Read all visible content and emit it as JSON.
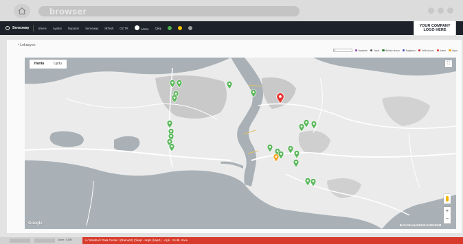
{
  "browser": {
    "url_text": "browser",
    "home_icon": "home-icon"
  },
  "nav": {
    "brand": "Sensoway",
    "items": [
      "Izleme",
      "Ayarlar",
      "Raporlar",
      "Sensoway",
      "IlkTeslt",
      "OZ TR",
      "Admin",
      "Çikiş"
    ],
    "icon_colors": [
      "#4caf50",
      "#f5c400",
      "#9e9e9e"
    ]
  },
  "logo": {
    "line1": "YOUR COMPANY",
    "line2": "LOGO HERE"
  },
  "page": {
    "section_title": "• Lokasyon"
  },
  "legend": {
    "filter_value": "1",
    "items": [
      {
        "label": "Harekete",
        "color": "#8e44ad"
      },
      {
        "label": "Yavaf",
        "color": "#555555"
      },
      {
        "label": "Belirsiz durum",
        "color": "#2e7d32"
      },
      {
        "label": "Bağlanan",
        "color": "#3f51b5"
      },
      {
        "label": "Kritik durum",
        "color": "#c62828"
      },
      {
        "label": "Alarm",
        "color": "#e53935"
      },
      {
        "label": "Uyarı",
        "color": "#f5a623"
      }
    ]
  },
  "map": {
    "tabs": [
      "Harita",
      "Uydu"
    ],
    "active_tab": "Harita",
    "google_label": "Google",
    "attribution": "Map data ©2020 Terms of Use Report a map error",
    "zoom_in": "+",
    "zoom_out": "−",
    "fullscreen": "⛶",
    "marker_colors": {
      "ok": "#5cb85c",
      "alarm": "#e53935",
      "warning": "#f5a623"
    },
    "markers": [
      {
        "status": "ok"
      },
      {
        "status": "ok"
      },
      {
        "status": "ok"
      },
      {
        "status": "ok"
      },
      {
        "status": "ok"
      },
      {
        "status": "ok"
      },
      {
        "status": "alarm"
      },
      {
        "status": "ok"
      },
      {
        "status": "ok"
      },
      {
        "status": "ok"
      },
      {
        "status": "ok"
      },
      {
        "status": "ok"
      },
      {
        "status": "ok"
      },
      {
        "status": "ok"
      },
      {
        "status": "ok"
      },
      {
        "status": "warning"
      },
      {
        "status": "ok"
      },
      {
        "status": "ok"
      },
      {
        "status": "ok"
      },
      {
        "status": "ok"
      },
      {
        "status": "ok"
      },
      {
        "status": "ok"
      },
      {
        "status": "ok"
      },
      {
        "status": "ok"
      }
    ]
  },
  "footer": {
    "zoom_text": "Zoom : 0,000",
    "breadcrumb": "s / Istanbul / Data Center / (Ramazit) Çikaşl - Hop1 (kapı1) · Açik · 15 dk. önce"
  }
}
